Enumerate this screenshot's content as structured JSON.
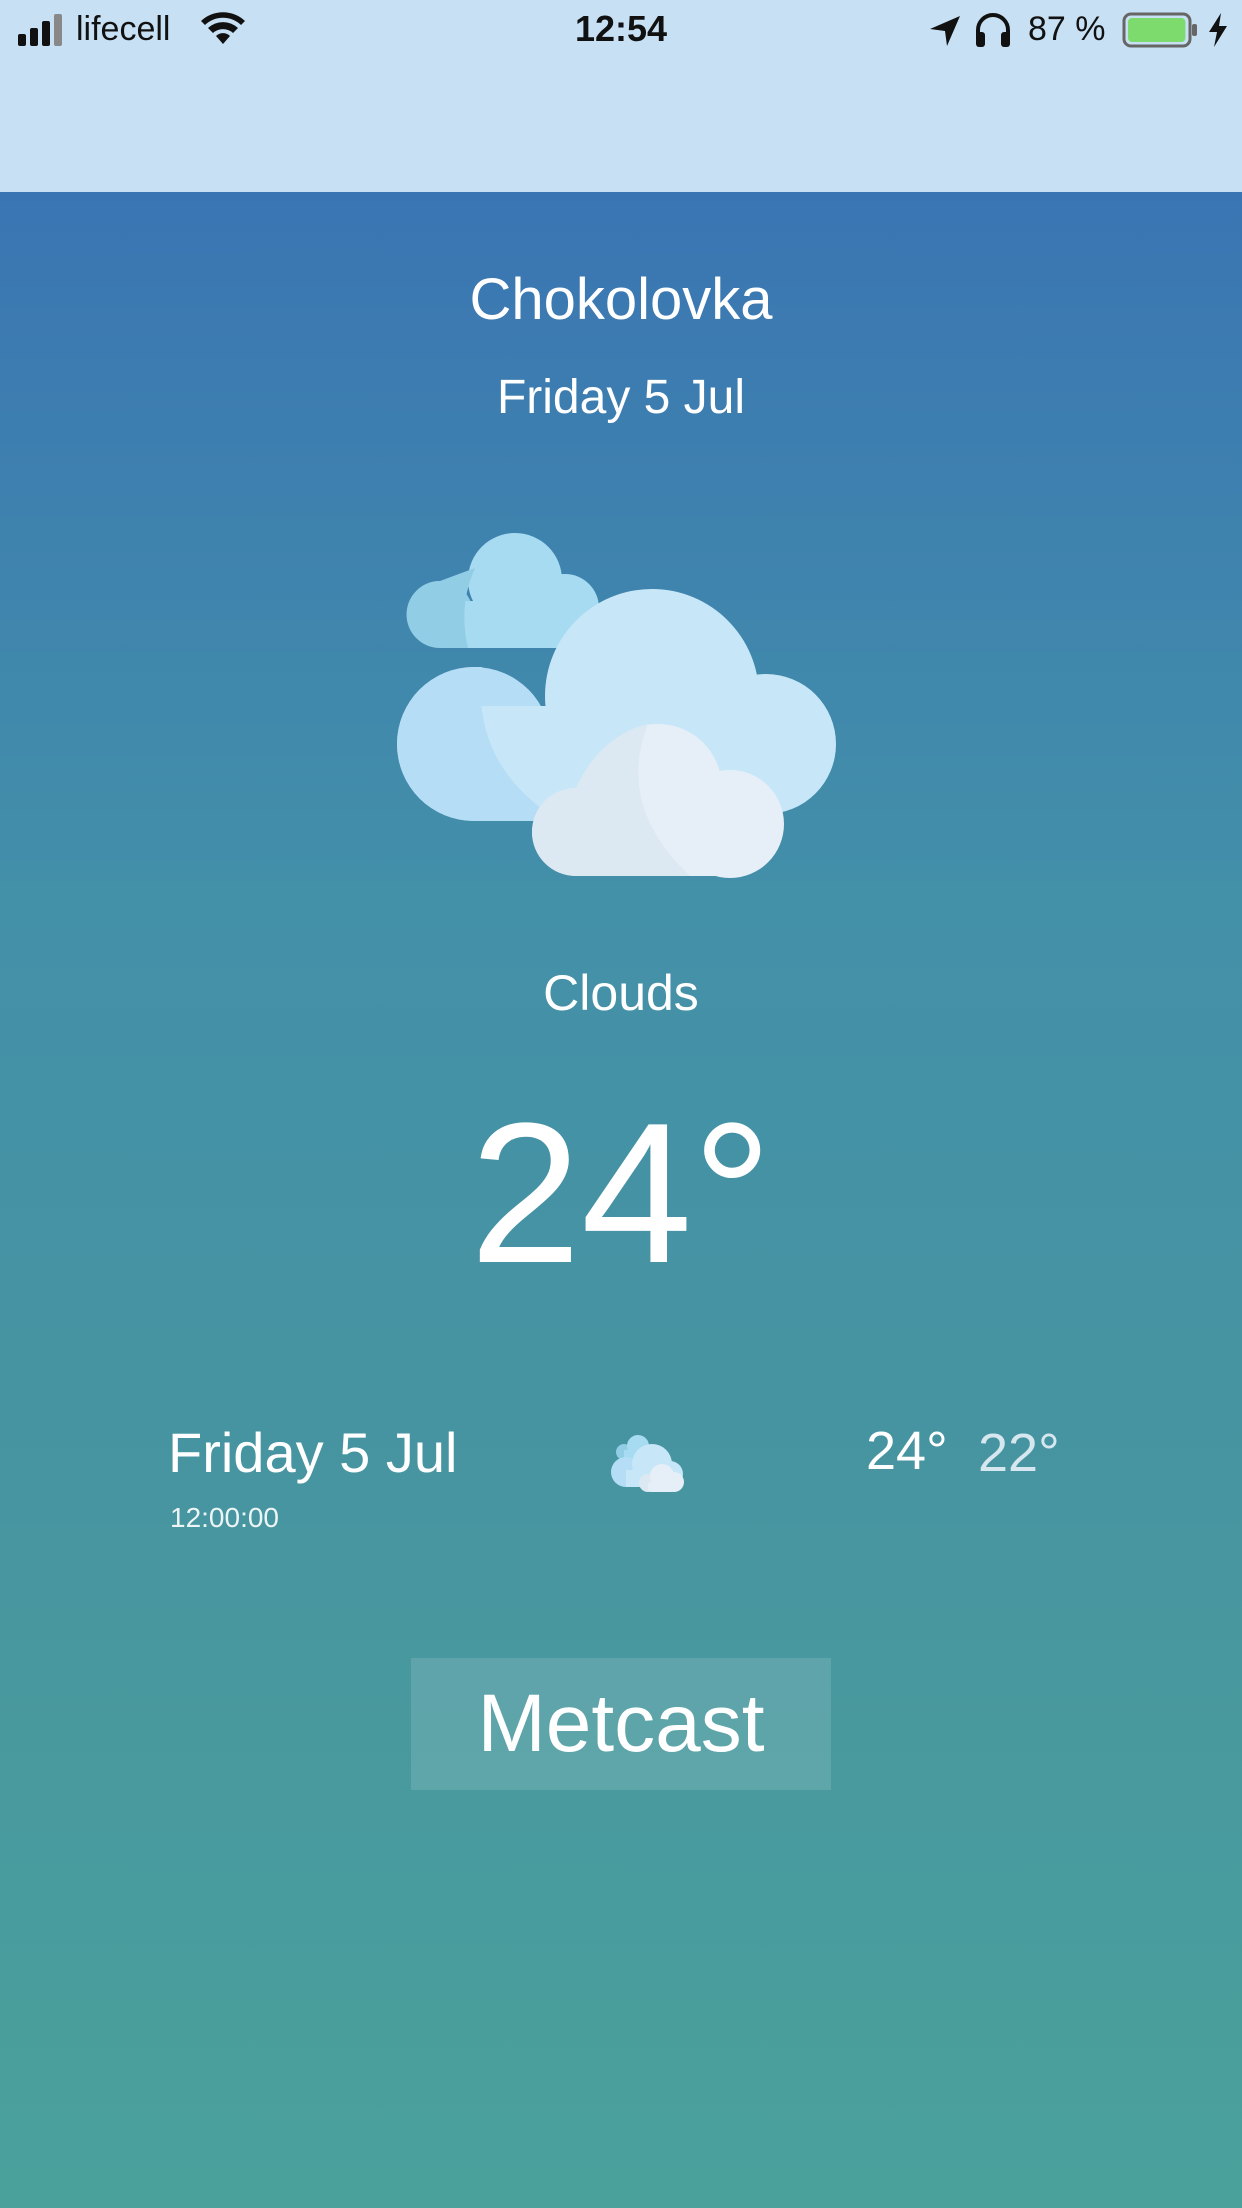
{
  "status_bar": {
    "carrier": "lifecell",
    "time": "12:54",
    "battery_percent": "87 %",
    "battery_level": 0.87,
    "icons": [
      "signal-icon",
      "wifi-icon",
      "location-arrow-icon",
      "headphones-icon",
      "battery-icon",
      "charging-bolt-icon"
    ]
  },
  "weather": {
    "city": "Chokolovka",
    "date": "Friday 5 Jul",
    "condition": "Clouds",
    "temperature": "24°",
    "icon": "clouds-icon"
  },
  "forecast": [
    {
      "date": "Friday 5 Jul",
      "time": "12:00:00",
      "icon": "clouds-small-icon",
      "max": "24°",
      "min": "22°"
    }
  ],
  "actions": {
    "metcast_label": "Metcast"
  },
  "colors": {
    "status_bar_bg": "#c7e0f4",
    "gradient_top": "#3a75b3",
    "gradient_bottom": "#4aa19b",
    "battery_fill": "#7ddb6e"
  }
}
